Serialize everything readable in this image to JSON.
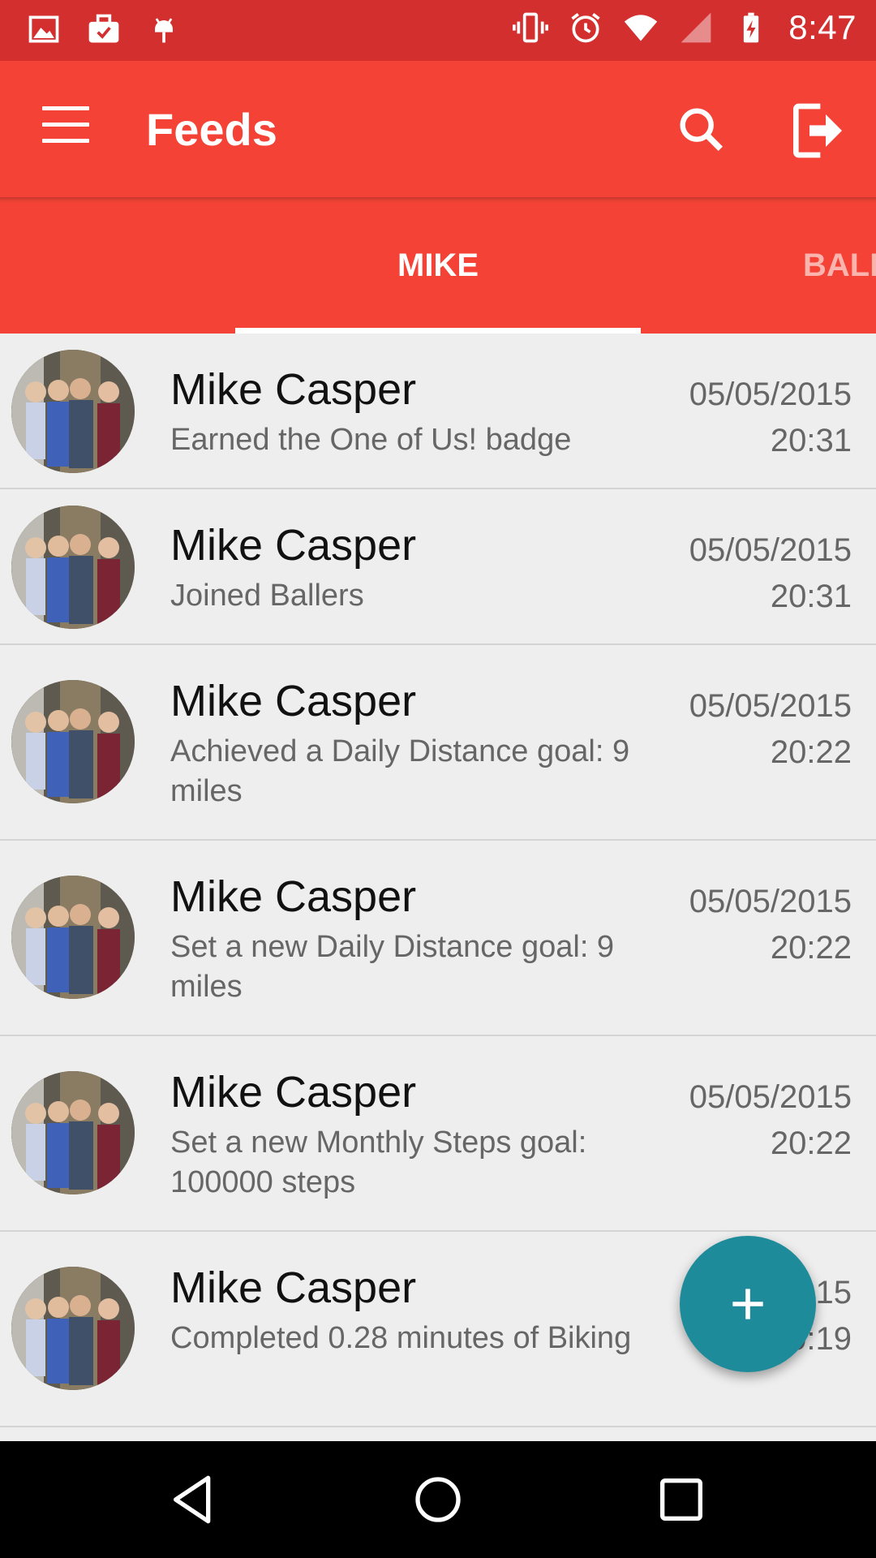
{
  "status_bar": {
    "time": "8:47",
    "color": "#d32f2f",
    "left_icons": [
      "image-icon",
      "work-briefcase-icon",
      "android-icon"
    ],
    "right_icons": [
      "vibrate-icon",
      "alarm-icon",
      "wifi-icon",
      "lte-signal-icon",
      "cell-signal-icon",
      "battery-charging-icon"
    ]
  },
  "app_bar": {
    "title": "Feeds",
    "color": "#f44336",
    "menu_icon": "menu-icon",
    "search_icon": "search-icon",
    "logout_icon": "logout-icon"
  },
  "tabs": [
    {
      "label": "MIKE",
      "selected": true
    },
    {
      "label": "BALL",
      "selected": false
    }
  ],
  "feed": [
    {
      "name": "Mike Casper",
      "activity": "Earned the One of Us! badge",
      "date": "05/05/2015",
      "time": "20:31"
    },
    {
      "name": "Mike Casper",
      "activity": "Joined Ballers",
      "date": "05/05/2015",
      "time": "20:31"
    },
    {
      "name": "Mike Casper",
      "activity": "Achieved a Daily Distance goal: 9 miles",
      "date": "05/05/2015",
      "time": "20:22"
    },
    {
      "name": "Mike Casper",
      "activity": "Set a new Daily Distance goal: 9 miles",
      "date": "05/05/2015",
      "time": "20:22"
    },
    {
      "name": "Mike Casper",
      "activity": "Set a new Monthly Steps goal: 100000 steps",
      "date": "05/05/2015",
      "time": "20:22"
    },
    {
      "name": "Mike Casper",
      "activity": "Completed 0.28 minutes of Biking",
      "date": "05/05/2015",
      "time": "20:19"
    }
  ],
  "fab": {
    "icon": "add-icon",
    "color": "#1e8b9b"
  },
  "nav_bar": {
    "buttons": [
      "back-icon",
      "home-icon",
      "recents-icon"
    ]
  }
}
